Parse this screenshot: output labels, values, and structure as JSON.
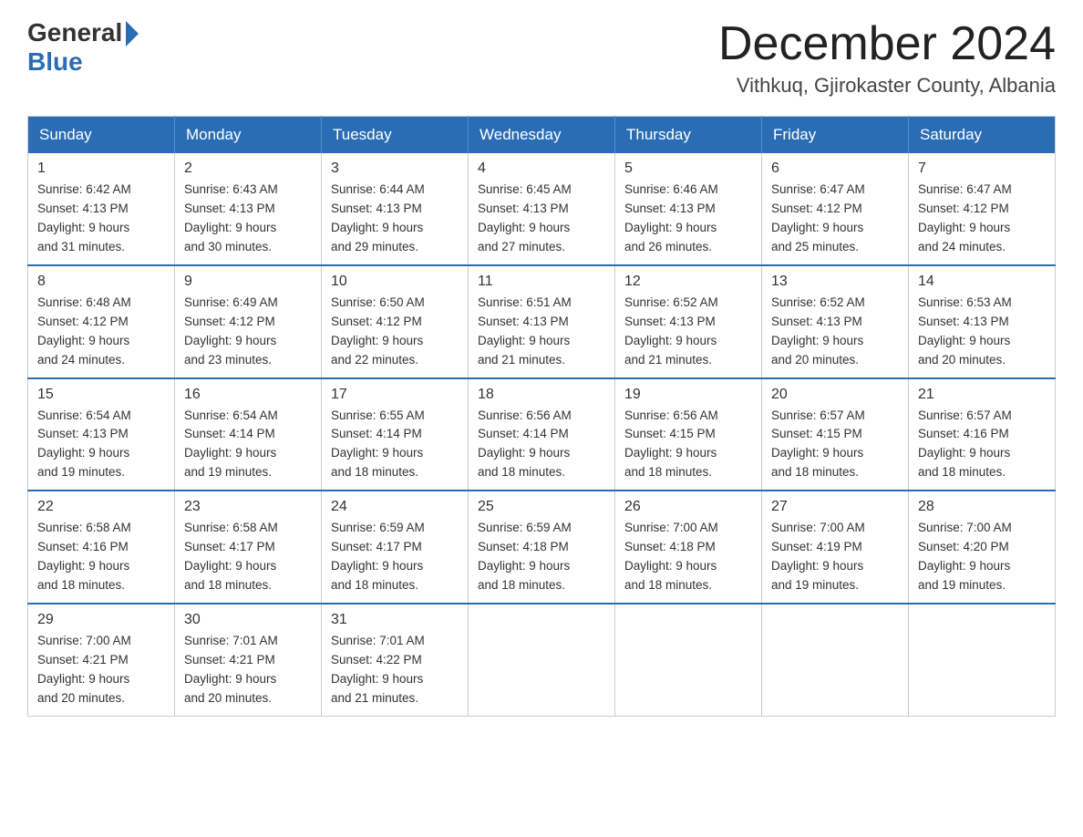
{
  "header": {
    "logo_general": "General",
    "logo_blue": "Blue",
    "month_title": "December 2024",
    "location": "Vithkuq, Gjirokaster County, Albania"
  },
  "days_of_week": [
    "Sunday",
    "Monday",
    "Tuesday",
    "Wednesday",
    "Thursday",
    "Friday",
    "Saturday"
  ],
  "weeks": [
    [
      {
        "day": "1",
        "sunrise": "6:42 AM",
        "sunset": "4:13 PM",
        "daylight": "9 hours and 31 minutes."
      },
      {
        "day": "2",
        "sunrise": "6:43 AM",
        "sunset": "4:13 PM",
        "daylight": "9 hours and 30 minutes."
      },
      {
        "day": "3",
        "sunrise": "6:44 AM",
        "sunset": "4:13 PM",
        "daylight": "9 hours and 29 minutes."
      },
      {
        "day": "4",
        "sunrise": "6:45 AM",
        "sunset": "4:13 PM",
        "daylight": "9 hours and 27 minutes."
      },
      {
        "day": "5",
        "sunrise": "6:46 AM",
        "sunset": "4:13 PM",
        "daylight": "9 hours and 26 minutes."
      },
      {
        "day": "6",
        "sunrise": "6:47 AM",
        "sunset": "4:12 PM",
        "daylight": "9 hours and 25 minutes."
      },
      {
        "day": "7",
        "sunrise": "6:47 AM",
        "sunset": "4:12 PM",
        "daylight": "9 hours and 24 minutes."
      }
    ],
    [
      {
        "day": "8",
        "sunrise": "6:48 AM",
        "sunset": "4:12 PM",
        "daylight": "9 hours and 24 minutes."
      },
      {
        "day": "9",
        "sunrise": "6:49 AM",
        "sunset": "4:12 PM",
        "daylight": "9 hours and 23 minutes."
      },
      {
        "day": "10",
        "sunrise": "6:50 AM",
        "sunset": "4:12 PM",
        "daylight": "9 hours and 22 minutes."
      },
      {
        "day": "11",
        "sunrise": "6:51 AM",
        "sunset": "4:13 PM",
        "daylight": "9 hours and 21 minutes."
      },
      {
        "day": "12",
        "sunrise": "6:52 AM",
        "sunset": "4:13 PM",
        "daylight": "9 hours and 21 minutes."
      },
      {
        "day": "13",
        "sunrise": "6:52 AM",
        "sunset": "4:13 PM",
        "daylight": "9 hours and 20 minutes."
      },
      {
        "day": "14",
        "sunrise": "6:53 AM",
        "sunset": "4:13 PM",
        "daylight": "9 hours and 20 minutes."
      }
    ],
    [
      {
        "day": "15",
        "sunrise": "6:54 AM",
        "sunset": "4:13 PM",
        "daylight": "9 hours and 19 minutes."
      },
      {
        "day": "16",
        "sunrise": "6:54 AM",
        "sunset": "4:14 PM",
        "daylight": "9 hours and 19 minutes."
      },
      {
        "day": "17",
        "sunrise": "6:55 AM",
        "sunset": "4:14 PM",
        "daylight": "9 hours and 18 minutes."
      },
      {
        "day": "18",
        "sunrise": "6:56 AM",
        "sunset": "4:14 PM",
        "daylight": "9 hours and 18 minutes."
      },
      {
        "day": "19",
        "sunrise": "6:56 AM",
        "sunset": "4:15 PM",
        "daylight": "9 hours and 18 minutes."
      },
      {
        "day": "20",
        "sunrise": "6:57 AM",
        "sunset": "4:15 PM",
        "daylight": "9 hours and 18 minutes."
      },
      {
        "day": "21",
        "sunrise": "6:57 AM",
        "sunset": "4:16 PM",
        "daylight": "9 hours and 18 minutes."
      }
    ],
    [
      {
        "day": "22",
        "sunrise": "6:58 AM",
        "sunset": "4:16 PM",
        "daylight": "9 hours and 18 minutes."
      },
      {
        "day": "23",
        "sunrise": "6:58 AM",
        "sunset": "4:17 PM",
        "daylight": "9 hours and 18 minutes."
      },
      {
        "day": "24",
        "sunrise": "6:59 AM",
        "sunset": "4:17 PM",
        "daylight": "9 hours and 18 minutes."
      },
      {
        "day": "25",
        "sunrise": "6:59 AM",
        "sunset": "4:18 PM",
        "daylight": "9 hours and 18 minutes."
      },
      {
        "day": "26",
        "sunrise": "7:00 AM",
        "sunset": "4:18 PM",
        "daylight": "9 hours and 18 minutes."
      },
      {
        "day": "27",
        "sunrise": "7:00 AM",
        "sunset": "4:19 PM",
        "daylight": "9 hours and 19 minutes."
      },
      {
        "day": "28",
        "sunrise": "7:00 AM",
        "sunset": "4:20 PM",
        "daylight": "9 hours and 19 minutes."
      }
    ],
    [
      {
        "day": "29",
        "sunrise": "7:00 AM",
        "sunset": "4:21 PM",
        "daylight": "9 hours and 20 minutes."
      },
      {
        "day": "30",
        "sunrise": "7:01 AM",
        "sunset": "4:21 PM",
        "daylight": "9 hours and 20 minutes."
      },
      {
        "day": "31",
        "sunrise": "7:01 AM",
        "sunset": "4:22 PM",
        "daylight": "9 hours and 21 minutes."
      },
      null,
      null,
      null,
      null
    ]
  ],
  "labels": {
    "sunrise": "Sunrise:",
    "sunset": "Sunset:",
    "daylight": "Daylight:"
  }
}
